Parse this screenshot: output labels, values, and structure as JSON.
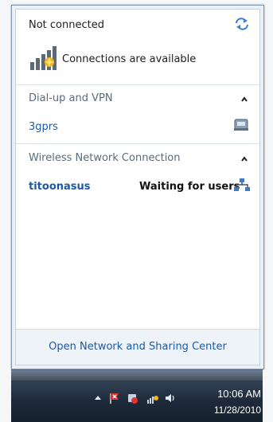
{
  "header": {
    "status": "Not connected"
  },
  "availability": {
    "text": "Connections are available"
  },
  "sections": {
    "dialup": {
      "title": "Dial-up and VPN",
      "items": [
        {
          "name": "3gprs"
        }
      ]
    },
    "wireless": {
      "title": "Wireless Network Connection",
      "items": [
        {
          "name": "titoonasus",
          "status": "Waiting for users"
        }
      ]
    }
  },
  "footer": {
    "link": "Open Network and Sharing Center"
  },
  "taskbar": {
    "time": "10:06 AM",
    "date": "11/28/2010"
  },
  "colors": {
    "link": "#1b5aa8",
    "section_title": "#5a6b7c",
    "taskbar": "#1e2a39"
  },
  "icons": [
    "refresh-icon",
    "signal-bars-icon",
    "chevron-up-icon",
    "dialup-modem-icon",
    "network-waiting-icon",
    "tray-flag-icon",
    "tray-network-icon",
    "tray-volume-icon"
  ]
}
